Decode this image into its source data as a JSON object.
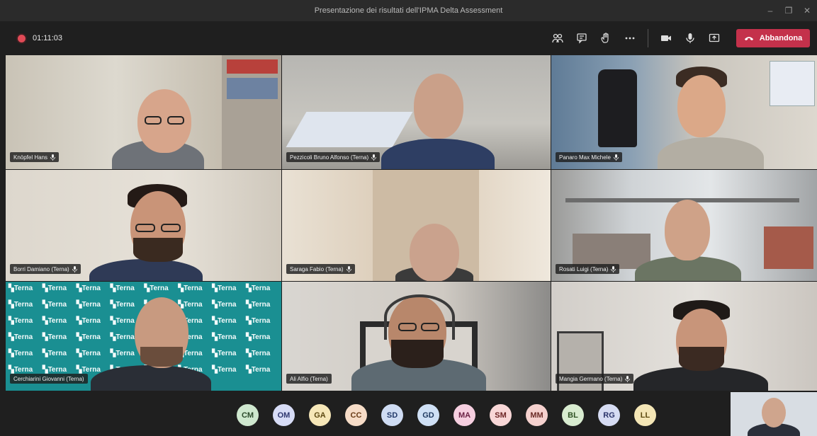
{
  "window": {
    "title": "Presentazione dei risultati dell'IPMA Delta Assessment"
  },
  "toolbar": {
    "timer": "01:11:03",
    "leave_label": "Abbandona",
    "icons": [
      "participants-icon",
      "chat-icon",
      "raise-hand-icon",
      "more-icon",
      "camera-icon",
      "microphone-icon",
      "share-screen-icon"
    ]
  },
  "participants": [
    {
      "name": "Knöpfel Hans"
    },
    {
      "name": "Pezzicoli Bruno Alfonso (Terna)"
    },
    {
      "name": "Panaro Max Michele"
    },
    {
      "name": "Borri Damiano (Terna)"
    },
    {
      "name": "Saraga Fabio (Terna)"
    },
    {
      "name": "Rosati Luigi (Terna)"
    },
    {
      "name": "Cerchiarini Giovanni (Terna)"
    },
    {
      "name": "Ali Alfio (Terna)"
    },
    {
      "name": "Mangia Germano (Terna)"
    }
  ],
  "background_brand": "Terna",
  "avatars": [
    {
      "initials": "CM",
      "bg": "#cfe8cf",
      "fg": "#2c4a2c"
    },
    {
      "initials": "OM",
      "bg": "#d7dcf6",
      "fg": "#2f3770"
    },
    {
      "initials": "GA",
      "bg": "#f6e7b8",
      "fg": "#5c4811"
    },
    {
      "initials": "CC",
      "bg": "#f6dcc7",
      "fg": "#6a3b16"
    },
    {
      "initials": "SD",
      "bg": "#cfdcf3",
      "fg": "#233a6a"
    },
    {
      "initials": "GD",
      "bg": "#cfe0f5",
      "fg": "#203a60"
    },
    {
      "initials": "MA",
      "bg": "#f6cfe0",
      "fg": "#6a1f43"
    },
    {
      "initials": "SM",
      "bg": "#f8d7d7",
      "fg": "#6c2424"
    },
    {
      "initials": "MM",
      "bg": "#f5d1ce",
      "fg": "#6b2b26"
    },
    {
      "initials": "BL",
      "bg": "#d8ecd0",
      "fg": "#2f5224"
    },
    {
      "initials": "RG",
      "bg": "#d6dcf3",
      "fg": "#2a336a"
    },
    {
      "initials": "LL",
      "bg": "#f4e6b6",
      "fg": "#5d4a10"
    }
  ],
  "colors": {
    "leave": "#c4314b",
    "recording": "#e04a56",
    "terra_bg": "#1a8f92"
  }
}
